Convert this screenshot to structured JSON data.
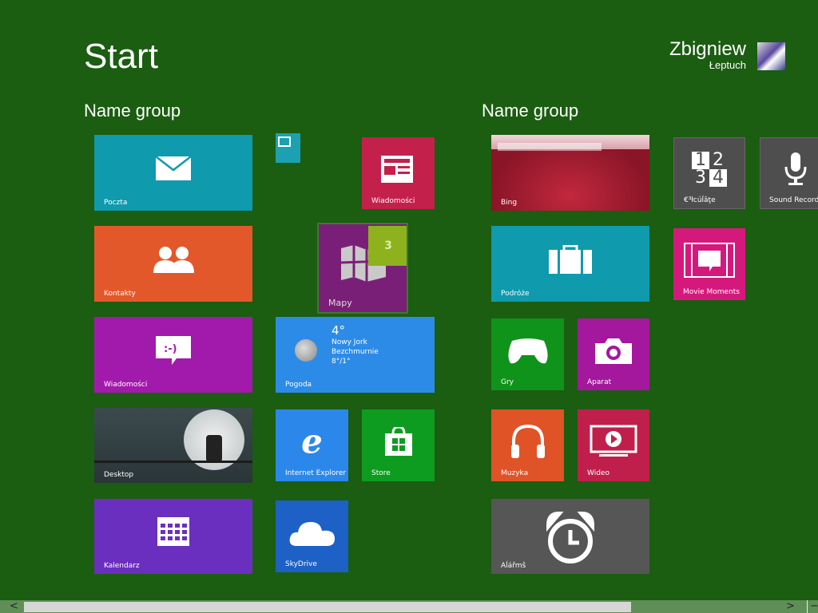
{
  "header": {
    "title": "Start",
    "user_first": "Zbigniew",
    "user_last": "Łeptuch"
  },
  "groups": [
    "Name group",
    "Name group"
  ],
  "tiles": {
    "poczta": "Poczta",
    "kontakty": "Kontakty",
    "wiadomosci_msg": "Wiadomości",
    "desktop": "Desktop",
    "kalendarz": "Kalendarz",
    "wiadomosci_news": "Wiadomości",
    "mapy": "Mapy",
    "mapy_badge": "3",
    "pogoda": "Pogoda",
    "weather": {
      "temp": "4°",
      "city": "Nowy Jork",
      "cond": "Bezchmurnie",
      "range": "8°/1°"
    },
    "ie": "Internet Explorer",
    "store": "Store",
    "skydrive": "SkyDrive",
    "bing": "Bing",
    "podroze": "Podróże",
    "gry": "Gry",
    "aparat": "Aparat",
    "muzyka": "Muzyka",
    "wideo": "Wideo",
    "alarms": "Aĺářmŝ",
    "calc": "€³łcúĺâţe",
    "calc_icon": [
      "1",
      "2",
      "3",
      "4"
    ],
    "sound": "Sound Recorder",
    "movie": "Movie Moments"
  },
  "colors": {
    "background": "#1b5d11",
    "teal": "#0f9aad",
    "orange": "#e3582a",
    "purple": "#a21aab",
    "violet": "#6b2fbf",
    "crimson": "#c4204c",
    "blue": "#2d8be8",
    "green": "#0e9c20",
    "grey": "#555555",
    "pink": "#d5197c"
  },
  "scrollbar": {
    "left": "<",
    "right": ">",
    "minus": "−"
  }
}
